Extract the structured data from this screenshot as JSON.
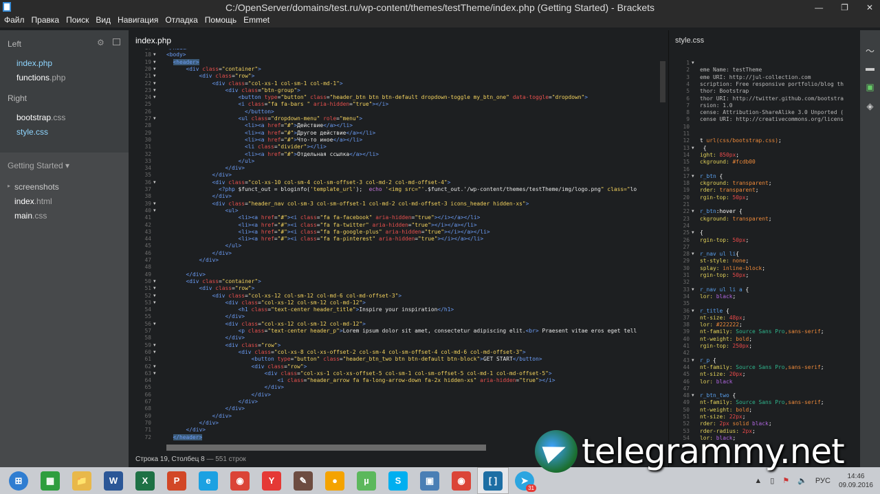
{
  "window": {
    "title": "C:/OpenServer/domains/test.ru/wp-content/themes/testTheme/index.php (Getting Started) - Brackets",
    "controls": [
      "—",
      "❐",
      "✕"
    ]
  },
  "menu": [
    "Файл",
    "Правка",
    "Поиск",
    "Вид",
    "Навигация",
    "Отладка",
    "Помощь",
    "Emmet"
  ],
  "sidebar": {
    "left_label": "Left",
    "left_files": [
      {
        "name": "index",
        "ext": ".php",
        "selected": true
      },
      {
        "name": "functions",
        "ext": ".php",
        "selected": false
      }
    ],
    "right_label": "Right",
    "right_files": [
      {
        "name": "bootstrap",
        "ext": ".css",
        "selected": false
      },
      {
        "name": "style",
        "ext": ".css",
        "selected": true
      }
    ],
    "project": "Getting Started ▾",
    "tree": [
      {
        "name": "screenshots",
        "folder": true
      },
      {
        "name": "index",
        "ext": ".html"
      },
      {
        "name": "main",
        "ext": ".css"
      }
    ]
  },
  "editor": {
    "tab": "index.php",
    "status": {
      "position": "Строка 19, Столбец 8",
      "lines": "— 551 строк"
    },
    "first_line": 17,
    "fold_lines": [
      18,
      19,
      20,
      21,
      22,
      23,
      24,
      27,
      36,
      39,
      40,
      50,
      51,
      52,
      53,
      56,
      59,
      60,
      62,
      63
    ],
    "lines": [
      "</head>",
      "<body>",
      "  <header>",
      "      <div class=\"container\">",
      "          <div class=\"row\">",
      "              <div class=\"col-xs-1 col-sm-1 col-md-1\">",
      "                  <div class=\"btn-group\">",
      "                      <button type=\"button\" class=\"header_btn btn btn-default dropdown-toggle my_btn_one\" data-toggle=\"dropdown\">",
      "                      <i class=\"fa fa-bars \" aria-hidden=\"true\"></i>",
      "                        </button>",
      "                      <ul class=\"dropdown-menu\" role=\"menu\">",
      "                        <li><a href=\"#\">Действие</a></li>",
      "                        <li><a href=\"#\">Другое действие</a></li>",
      "                        <li><a href=\"#\">Что-то иное</a></li>",
      "                        <li class=\"divider\"></li>",
      "                        <li><a href=\"#\">Отдельная ссылка</a></li>",
      "                      </ul>",
      "                  </div>",
      "              </div>",
      "              <div class=\"col-xs-10 col-sm-4 col-sm-offset-3 col-md-2 col-md-offset-4\">",
      "                <?php $funct_out = bloginfo('template_url');  echo '<img src=\"'.$funct_out.'/wp-content/themes/testTheme/img/logo.png\" class=\"lo",
      "              </div>",
      "              <div class=\"header_nav col-sm-3 col-sm-offset-1 col-md-2 col-md-offset-3 icons_header hidden-xs\">",
      "                  <ul>",
      "                      <li><a href=\"#\"><i class=\"fa fa-facebook\" aria-hidden=\"true\"></i></a></li>",
      "                      <li><a href=\"#\"><i class=\"fa fa-twitter\" aria-hidden=\"true\"></i></a></li>",
      "                      <li><a href=\"#\"><i class=\"fa fa-google-plus\" aria-hidden=\"true\"></i></a></li>",
      "                      <li><a href=\"#\"><i class=\"fa fa-pinterest\" aria-hidden=\"true\"></i></a></li>",
      "                  </ul>",
      "              </div>",
      "          </div>",
      "",
      "      </div>",
      "      <div class=\"container\">",
      "          <div class=\"row\">",
      "              <div class=\"col-xs-12 col-sm-12 col-md-6 col-md-offset-3\">",
      "                  <div class=\"col-xs-12 col-sm-12 col-md-12\">",
      "                      <h1 class=\"text-center header_title\">Inspire your inspiration</h1>",
      "                  </div>",
      "                  <div class=\"col-xs-12 col-sm-12 col-md-12\">",
      "                      <p class=\"text-center header_p\">Lorem ipsum dolor sit amet, consectetur adipiscing elit.<br> Praesent vitae eros eget tell",
      "                  </div>",
      "                  <div class=\"row\">",
      "                      <div class=\"col-xs-8 col-xs-offset-2 col-sm-4 col-sm-offset-4 col-md-6 col-md-offset-3\">",
      "                          <button type=\"button\" class=\"header_btn_two btn btn-default btn-block\">GET START</button>",
      "                          <div class=\"row\">",
      "                              <div class=\"col-xs-1 col-xs-offset-5 col-sm-1 col-sm-offset-5 col-md-1 col-md-offset-5\">",
      "                                  <i class=\"header_arrow fa fa-long-arrow-down fa-2x hidden-xs\" aria-hidden=\"true\"></i>",
      "                              </div>",
      "                          </div>",
      "                      </div>",
      "                  </div>",
      "              </div>",
      "          </div>",
      "      </div>",
      "  </header>"
    ]
  },
  "right_pane": {
    "tab": "style.css",
    "fold_lines": [
      1,
      13,
      17,
      22,
      25,
      28,
      33,
      36,
      43,
      48
    ],
    "lines": [
      [],
      [
        [
          "eme Name: testTheme",
          "cm"
        ]
      ],
      [
        [
          "eme URI: http://jul-collection.com",
          "cm"
        ]
      ],
      [
        [
          "scription: Free responsive portfolio/blog th",
          "cm"
        ]
      ],
      [
        [
          "thor: Bootstrap",
          "cm"
        ]
      ],
      [
        [
          "thor URI: http://twitter.github.com/bootstra",
          "cm"
        ]
      ],
      [
        [
          "rsion: 1.0",
          "cm"
        ]
      ],
      [
        [
          "cense: Attribution-ShareAlike 3.0 Unported (",
          "cm"
        ]
      ],
      [
        [
          "cense URI: http://creativecommons.org/licens",
          "cm"
        ]
      ],
      [],
      [],
      [
        [
          "t ",
          "w"
        ],
        [
          "url(css/bootstrap.css)",
          "v"
        ],
        [
          ";",
          "w"
        ]
      ],
      [
        [
          " {",
          "w"
        ]
      ],
      [
        [
          "ight: ",
          "pr"
        ],
        [
          "850px",
          "n"
        ],
        [
          ";",
          "w"
        ]
      ],
      [
        [
          "ckground: ",
          "pr"
        ],
        [
          "#fcdb00",
          "v"
        ]
      ],
      [],
      [
        [
          "r_btn",
          "sel"
        ],
        [
          " {",
          "w"
        ]
      ],
      [
        [
          "ckground: ",
          "pr"
        ],
        [
          "transparent",
          "v"
        ],
        [
          ";",
          "w"
        ]
      ],
      [
        [
          "rder: ",
          "pr"
        ],
        [
          "transparent",
          "v"
        ],
        [
          ";",
          "w"
        ]
      ],
      [
        [
          "rgin-top: ",
          "pr"
        ],
        [
          "50px",
          "n"
        ],
        [
          ";",
          "w"
        ]
      ],
      [],
      [
        [
          "r_btn",
          "sel"
        ],
        [
          ":hover {",
          "w"
        ]
      ],
      [
        [
          "ckground: ",
          "pr"
        ],
        [
          "transparent",
          "v"
        ],
        [
          ";",
          "w"
        ]
      ],
      [],
      [
        [
          "{",
          "w"
        ]
      ],
      [
        [
          "rgin-top: ",
          "pr"
        ],
        [
          "50px",
          "n"
        ],
        [
          ";",
          "w"
        ]
      ],
      [],
      [
        [
          "r_nav ul li",
          "sel"
        ],
        [
          "{",
          "w"
        ]
      ],
      [
        [
          "st-style: ",
          "pr"
        ],
        [
          "none",
          "v"
        ],
        [
          ";",
          "w"
        ]
      ],
      [
        [
          "splay: ",
          "pr"
        ],
        [
          "inline-block",
          "v"
        ],
        [
          ";",
          "w"
        ]
      ],
      [
        [
          "rgin-top: ",
          "pr"
        ],
        [
          "50px",
          "n"
        ],
        [
          ";",
          "w"
        ]
      ],
      [],
      [
        [
          "r_nav ul li a",
          "sel"
        ],
        [
          " {",
          "w"
        ]
      ],
      [
        [
          "lor: ",
          "pr"
        ],
        [
          "black",
          "k"
        ],
        [
          ";",
          "w"
        ]
      ],
      [],
      [
        [
          "r_title",
          "sel"
        ],
        [
          " {",
          "w"
        ]
      ],
      [
        [
          "nt-size: ",
          "pr"
        ],
        [
          "48px",
          "n"
        ],
        [
          ";",
          "w"
        ]
      ],
      [
        [
          "lor: ",
          "pr"
        ],
        [
          "#222222",
          "v"
        ],
        [
          ";",
          "w"
        ]
      ],
      [
        [
          "nt-family: ",
          "pr"
        ],
        [
          "Source Sans Pro",
          "g"
        ],
        [
          ",sans-serif",
          "v"
        ],
        [
          ";",
          "w"
        ]
      ],
      [
        [
          "nt-weight: ",
          "pr"
        ],
        [
          "bold",
          "v"
        ],
        [
          ";",
          "w"
        ]
      ],
      [
        [
          "rgin-top: ",
          "pr"
        ],
        [
          "250px",
          "n"
        ],
        [
          ";",
          "w"
        ]
      ],
      [],
      [
        [
          "r_p",
          "sel"
        ],
        [
          " {",
          "w"
        ]
      ],
      [
        [
          "nt-family: ",
          "pr"
        ],
        [
          "Source Sans Pro",
          "g"
        ],
        [
          ",sans-serif",
          "v"
        ],
        [
          ";",
          "w"
        ]
      ],
      [
        [
          "nt-size: ",
          "pr"
        ],
        [
          "20px",
          "n"
        ],
        [
          ";",
          "w"
        ]
      ],
      [
        [
          "lor: ",
          "pr"
        ],
        [
          "black",
          "k"
        ]
      ],
      [],
      [
        [
          "r_btn_two",
          "sel"
        ],
        [
          " {",
          "w"
        ]
      ],
      [
        [
          "nt-family: ",
          "pr"
        ],
        [
          "Source Sans Pro",
          "g"
        ],
        [
          ",sans-serif",
          "v"
        ],
        [
          ";",
          "w"
        ]
      ],
      [
        [
          "nt-weight: ",
          "pr"
        ],
        [
          "bold",
          "v"
        ],
        [
          ";",
          "w"
        ]
      ],
      [
        [
          "nt-size: ",
          "pr"
        ],
        [
          "22px",
          "n"
        ],
        [
          ";",
          "w"
        ]
      ],
      [
        [
          "rder: ",
          "pr"
        ],
        [
          "2px",
          "n"
        ],
        [
          " solid ",
          "v"
        ],
        [
          "black",
          "k"
        ],
        [
          ";",
          "w"
        ]
      ],
      [
        [
          "rder-radius: ",
          "pr"
        ],
        [
          "2px",
          "n"
        ],
        [
          ";",
          "w"
        ]
      ],
      [
        [
          "lor: ",
          "pr"
        ],
        [
          "black",
          "k"
        ],
        [
          ";",
          "w"
        ]
      ]
    ]
  },
  "watermark": "telegrammy.net",
  "taskbar": {
    "apps": [
      {
        "name": "start",
        "label": "⊞",
        "color": "#2f7dd1"
      },
      {
        "name": "green-app",
        "label": "▦",
        "color": "#2e9e3e"
      },
      {
        "name": "file-explorer",
        "label": "📁",
        "color": "#e8b84a"
      },
      {
        "name": "word",
        "label": "W",
        "color": "#2b5797"
      },
      {
        "name": "excel",
        "label": "X",
        "color": "#1e7145"
      },
      {
        "name": "powerpoint",
        "label": "P",
        "color": "#d24726"
      },
      {
        "name": "internet-explorer",
        "label": "e",
        "color": "#1ba1e2"
      },
      {
        "name": "chrome",
        "label": "◉",
        "color": "#db4437"
      },
      {
        "name": "yandex-browser",
        "label": "Y",
        "color": "#e53935"
      },
      {
        "name": "app-tool",
        "label": "✎",
        "color": "#6d4c41"
      },
      {
        "name": "color-ball",
        "label": "●",
        "color": "#f4a300"
      },
      {
        "name": "utorrent",
        "label": "µ",
        "color": "#5cb85c"
      },
      {
        "name": "skype",
        "label": "S",
        "color": "#00aff0"
      },
      {
        "name": "network-app",
        "label": "▣",
        "color": "#4a7fb5"
      },
      {
        "name": "chrome-2",
        "label": "◉",
        "color": "#db4437"
      },
      {
        "name": "brackets",
        "label": "[ ]",
        "color": "#1c6ea4",
        "active": true
      },
      {
        "name": "telegram",
        "label": "➤",
        "color": "#2ca5e0",
        "badge": "31"
      }
    ],
    "tray": {
      "arrow": "▲",
      "language": "РУС",
      "time": "14:46",
      "date": "09.09.2016"
    }
  }
}
